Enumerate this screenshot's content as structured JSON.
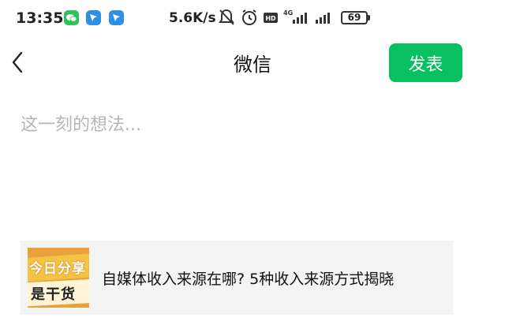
{
  "status_bar": {
    "time": "13:35",
    "net_speed": "5.6K/s",
    "network_label": "4G",
    "hd_label": "HD",
    "battery_percent": "69"
  },
  "header": {
    "title": "微信",
    "publish_label": "发表"
  },
  "compose": {
    "placeholder": "这一刻的想法..."
  },
  "share_card": {
    "thumbnail_line1": "今日分享",
    "thumbnail_line2": "是干货",
    "title": "自媒体收入来源在哪? 5种收入来源方式揭晓"
  },
  "colors": {
    "accent": "#07c160",
    "card_background": "#f4f4f4",
    "placeholder": "#b6b6b6"
  }
}
